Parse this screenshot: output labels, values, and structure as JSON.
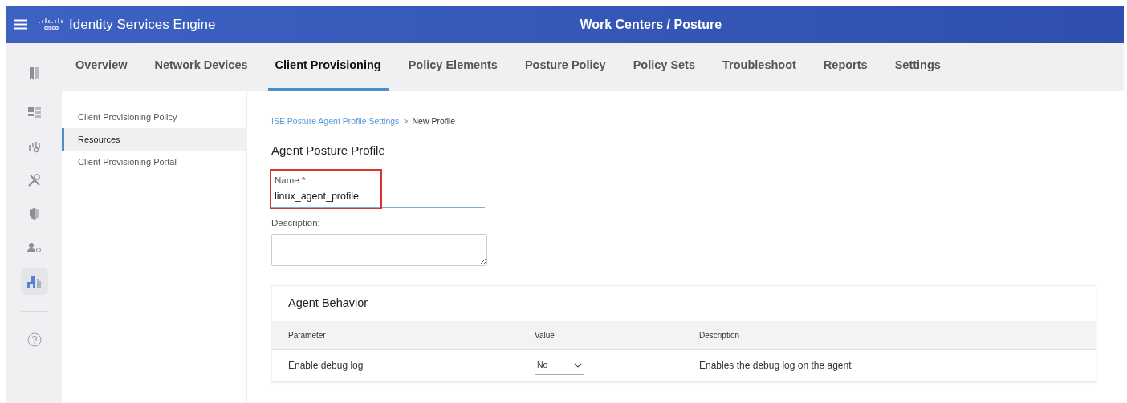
{
  "header": {
    "logo_text": "cisco",
    "app_title": "Identity Services Engine",
    "page_title": "Work Centers / Posture"
  },
  "tabs": [
    {
      "label": "Overview",
      "selected": false
    },
    {
      "label": "Network Devices",
      "selected": false
    },
    {
      "label": "Client Provisioning",
      "selected": true
    },
    {
      "label": "Policy Elements",
      "selected": false
    },
    {
      "label": "Posture Policy",
      "selected": false
    },
    {
      "label": "Policy Sets",
      "selected": false
    },
    {
      "label": "Troubleshoot",
      "selected": false
    },
    {
      "label": "Reports",
      "selected": false
    },
    {
      "label": "Settings",
      "selected": false
    }
  ],
  "rail": [
    {
      "kind": "dashboard",
      "selected": false
    },
    {
      "kind": "context",
      "selected": false
    },
    {
      "kind": "tools",
      "selected": false
    },
    {
      "kind": "shield",
      "selected": false
    },
    {
      "kind": "user",
      "selected": false
    },
    {
      "kind": "workcenter",
      "selected": true
    },
    {
      "kind": "help",
      "selected": false
    }
  ],
  "sidebar": {
    "items": [
      {
        "label": "Client Provisioning Policy",
        "selected": false
      },
      {
        "label": "Resources",
        "selected": true
      },
      {
        "label": "Client Provisioning Portal",
        "selected": false
      }
    ]
  },
  "breadcrumb": {
    "link": "ISE Posture Agent Profile Settings",
    "separator": ">",
    "current": "New Profile"
  },
  "heading": "Agent Posture Profile",
  "name_field": {
    "label": "Name",
    "required_mark": "*",
    "value": "linux_agent_profile",
    "highlighted": true
  },
  "description_field": {
    "label": "Description:"
  },
  "agent_behavior": {
    "title": "Agent Behavior",
    "columns": [
      "Parameter",
      "Value",
      "Description"
    ],
    "rows": [
      {
        "parameter": "Enable debug log",
        "value": "No",
        "description": "Enables the debug log on the agent"
      }
    ]
  }
}
